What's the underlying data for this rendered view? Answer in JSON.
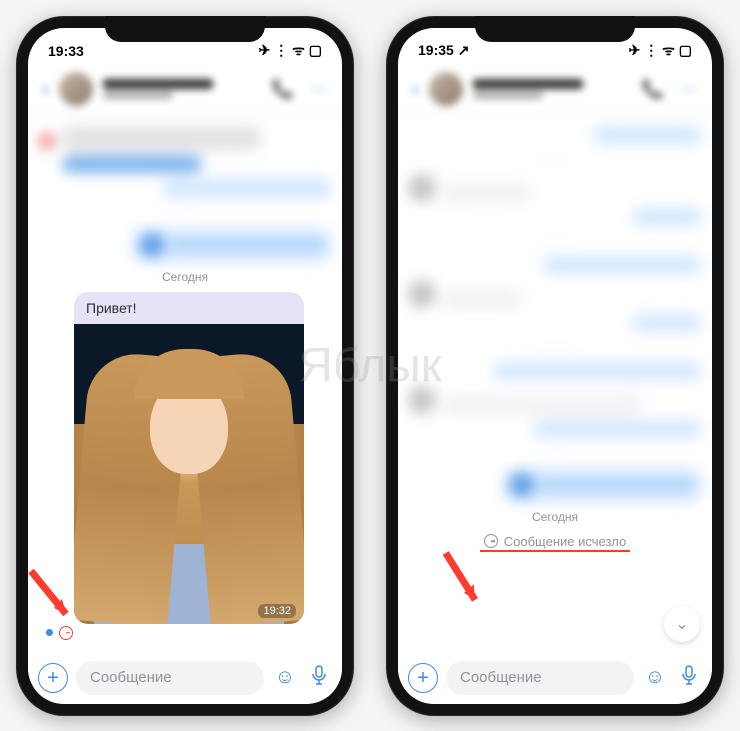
{
  "watermark": "Яблык",
  "phone1": {
    "status": {
      "time": "19:33",
      "icons": "✈ ⋮ ᯤ ▢"
    },
    "chat": {
      "date_separator": "Сегодня",
      "message_text": "Привет!",
      "message_time": "19:32"
    },
    "input": {
      "plus": "+",
      "placeholder": "Сообщение",
      "emoji": "☺",
      "mic": "🎤"
    }
  },
  "phone2": {
    "status": {
      "time": "19:35 ↗",
      "icons": "✈ ⋮ ᯤ ▢"
    },
    "chat": {
      "date_separator": "Сегодня",
      "disappeared_text": "Сообщение исчезло",
      "chevron": "⌄"
    },
    "input": {
      "plus": "+",
      "placeholder": "Сообщение",
      "emoji": "☺",
      "mic": "🎤"
    }
  }
}
